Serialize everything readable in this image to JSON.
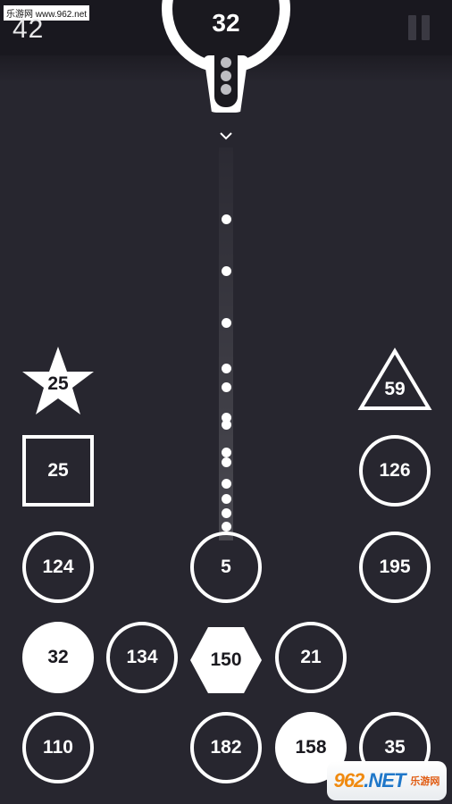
{
  "watermark_top": "乐游网 www.962.net",
  "hud": {
    "score": "42",
    "pause_icon": "pause-icon"
  },
  "launcher": {
    "ball_count": "32"
  },
  "aim_icon": "chevron-down-icon",
  "colors": {
    "background": "#27262f",
    "top_band": "#19181f",
    "block": "#ffffff",
    "dark_text": "#1a191f"
  },
  "blocks": [
    {
      "shape": "star",
      "value": "25"
    },
    {
      "shape": "triangle",
      "value": "59"
    },
    {
      "shape": "square",
      "value": "25"
    },
    {
      "shape": "circle",
      "value": "126"
    },
    {
      "shape": "circle",
      "value": "124"
    },
    {
      "shape": "circle",
      "value": "5"
    },
    {
      "shape": "circle",
      "value": "195"
    },
    {
      "shape": "circle-filled",
      "value": "32"
    },
    {
      "shape": "circle",
      "value": "134"
    },
    {
      "shape": "hexagon",
      "value": "150"
    },
    {
      "shape": "circle",
      "value": "21"
    },
    {
      "shape": "circle",
      "value": "110"
    },
    {
      "shape": "circle",
      "value": "182"
    },
    {
      "shape": "circle-filled",
      "value": "158"
    },
    {
      "shape": "circle",
      "value": "35"
    }
  ],
  "watermark_bottom": {
    "logo": "962",
    "domain": ".NET",
    "caption": "乐游网"
  }
}
